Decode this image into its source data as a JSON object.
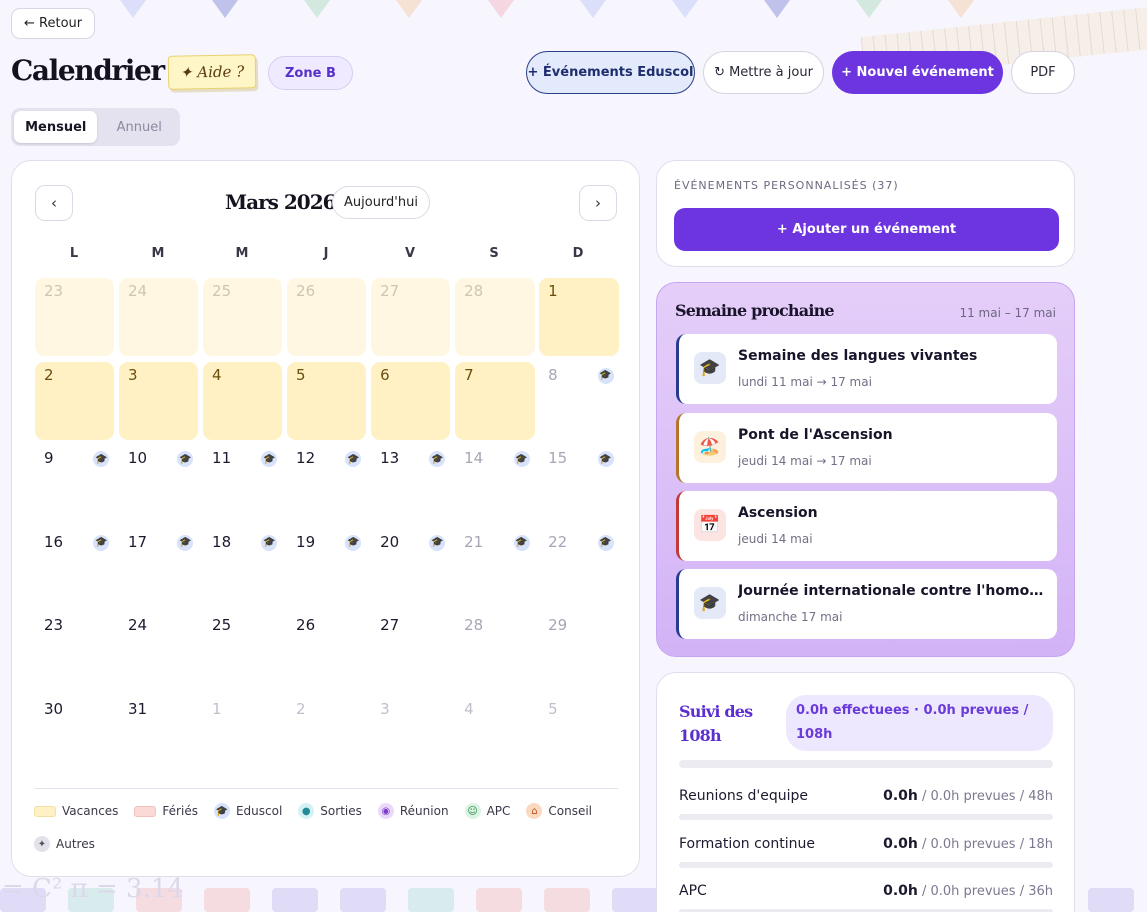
{
  "topbar": {
    "back_label": "← Retour",
    "title": "Calendrier",
    "help_label": "Aide ?",
    "zone_label": "Zone B",
    "eduscol_label": "+ Événements Eduscol",
    "refresh_label": "↻ Mettre à jour",
    "new_event_label": "+ Nouvel événement",
    "pdf_label": "PDF"
  },
  "view_toggle": {
    "monthly": "Mensuel",
    "yearly": "Annuel",
    "active": "monthly"
  },
  "calendar": {
    "month_label": "Mars 2026",
    "today_label": "Aujourd'hui",
    "prev_label": "‹",
    "next_label": "›",
    "weekdays": [
      "L",
      "M",
      "M",
      "J",
      "V",
      "S",
      "D"
    ],
    "weeks": [
      [
        {
          "d": "23",
          "out": true,
          "vac": true
        },
        {
          "d": "24",
          "out": true,
          "vac": true
        },
        {
          "d": "25",
          "out": true,
          "vac": true
        },
        {
          "d": "26",
          "out": true,
          "vac": true
        },
        {
          "d": "27",
          "out": true,
          "vac": true
        },
        {
          "d": "28",
          "out": true,
          "vac": true
        },
        {
          "d": "1",
          "vac": true
        }
      ],
      [
        {
          "d": "2",
          "vac": true
        },
        {
          "d": "3",
          "vac": true
        },
        {
          "d": "4",
          "vac": true
        },
        {
          "d": "5",
          "vac": true
        },
        {
          "d": "6",
          "vac": true
        },
        {
          "d": "7",
          "vac": true
        },
        {
          "d": "8",
          "weekend": true,
          "edu": true
        }
      ],
      [
        {
          "d": "9",
          "edu": true
        },
        {
          "d": "10",
          "edu": true
        },
        {
          "d": "11",
          "edu": true
        },
        {
          "d": "12",
          "edu": true
        },
        {
          "d": "13",
          "edu": true
        },
        {
          "d": "14",
          "weekend": true,
          "edu": true
        },
        {
          "d": "15",
          "weekend": true,
          "edu": true
        }
      ],
      [
        {
          "d": "16",
          "edu": true
        },
        {
          "d": "17",
          "edu": true
        },
        {
          "d": "18",
          "edu": true
        },
        {
          "d": "19",
          "edu": true
        },
        {
          "d": "20",
          "edu": true
        },
        {
          "d": "21",
          "weekend": true,
          "edu": true
        },
        {
          "d": "22",
          "weekend": true,
          "edu": true
        }
      ],
      [
        {
          "d": "23"
        },
        {
          "d": "24"
        },
        {
          "d": "25"
        },
        {
          "d": "26"
        },
        {
          "d": "27"
        },
        {
          "d": "28",
          "weekend": true
        },
        {
          "d": "29",
          "weekend": true
        }
      ],
      [
        {
          "d": "30"
        },
        {
          "d": "31"
        },
        {
          "d": "1",
          "out": true
        },
        {
          "d": "2",
          "out": true
        },
        {
          "d": "3",
          "out": true
        },
        {
          "d": "4",
          "out": true
        },
        {
          "d": "5",
          "out": true
        }
      ]
    ],
    "legend": {
      "vacances": "Vacances",
      "feries": "Fériés",
      "eduscol": "Eduscol",
      "sorties": "Sorties",
      "reunion": "Réunion",
      "apc": "APC",
      "conseil": "Conseil",
      "autres": "Autres"
    }
  },
  "custom_events": {
    "title": "ÉVÉNEMENTS PERSONNALISÉS (37)",
    "add_label": "+ Ajouter un événement"
  },
  "next_week": {
    "title": "Semaine prochaine",
    "range": "11 mai – 17 mai",
    "events": [
      {
        "icon": "🎓",
        "name": "Semaine des langues vivantes",
        "date": "lundi 11 mai → 17 mai",
        "color": "#2a3b8f",
        "icon_bg": "#e4e9f7"
      },
      {
        "icon": "🏖️",
        "name": "Pont de l'Ascension",
        "date": "jeudi 14 mai → 17 mai",
        "color": "#b5742a",
        "icon_bg": "#fdf1dd"
      },
      {
        "icon": "📅",
        "name": "Ascension",
        "date": "jeudi 14 mai",
        "color": "#c23a3a",
        "icon_bg": "#fbe4e2"
      },
      {
        "icon": "🎓",
        "name": "Journée internationale contre l'homophobie",
        "date": "dimanche 17 mai",
        "color": "#2a3b8f",
        "icon_bg": "#e4e9f7"
      }
    ]
  },
  "tracking": {
    "title": "Suivi des 108h",
    "badge": "0.0h effectuees · 0.0h prevues / 108h",
    "total_progress": 0,
    "rows": [
      {
        "label": "Reunions d'equipe",
        "done": "0.0h",
        "rest": " / 0.0h prevues / 48h",
        "progress": 0
      },
      {
        "label": "Formation continue",
        "done": "0.0h",
        "rest": " / 0.0h prevues / 18h",
        "progress": 0
      },
      {
        "label": "APC",
        "done": "0.0h",
        "rest": " / 0.0h prevues / 36h",
        "progress": 0
      }
    ]
  }
}
